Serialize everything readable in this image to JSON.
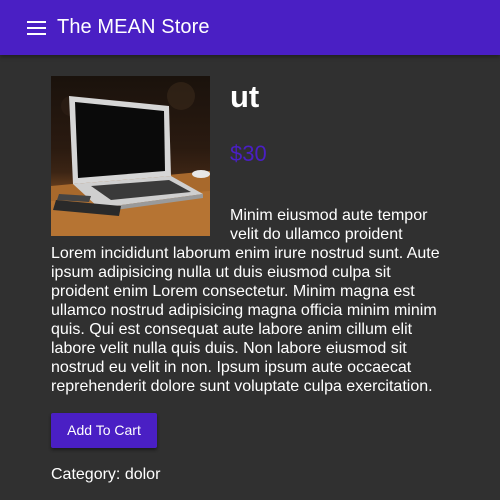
{
  "toolbar": {
    "menu_icon": "menu-icon",
    "title": "The MEAN Store"
  },
  "product": {
    "image_alt": "laptop on wooden desk",
    "name": "ut",
    "price": "$30",
    "description": "Minim eiusmod aute tempor velit do ullamco proident Lorem incididunt laborum enim irure nostrud sunt. Aute ipsum adipisicing nulla ut duis eiusmod culpa sit proident enim Lorem consectetur. Minim magna est ullamco nostrud adipisicing magna officia minim minim quis. Qui est consequat aute labore anim cillum elit labore velit nulla quis duis. Non labore eiusmod sit nostrud eu velit in non. Ipsum ipsum aute occaecat reprehenderit dolore sunt voluptate culpa exercitation.",
    "add_to_cart_label": "Add To Cart",
    "category": "Category: dolor"
  },
  "colors": {
    "primary": "#4a1fc4",
    "background": "#303030",
    "text": "#ffffff"
  }
}
